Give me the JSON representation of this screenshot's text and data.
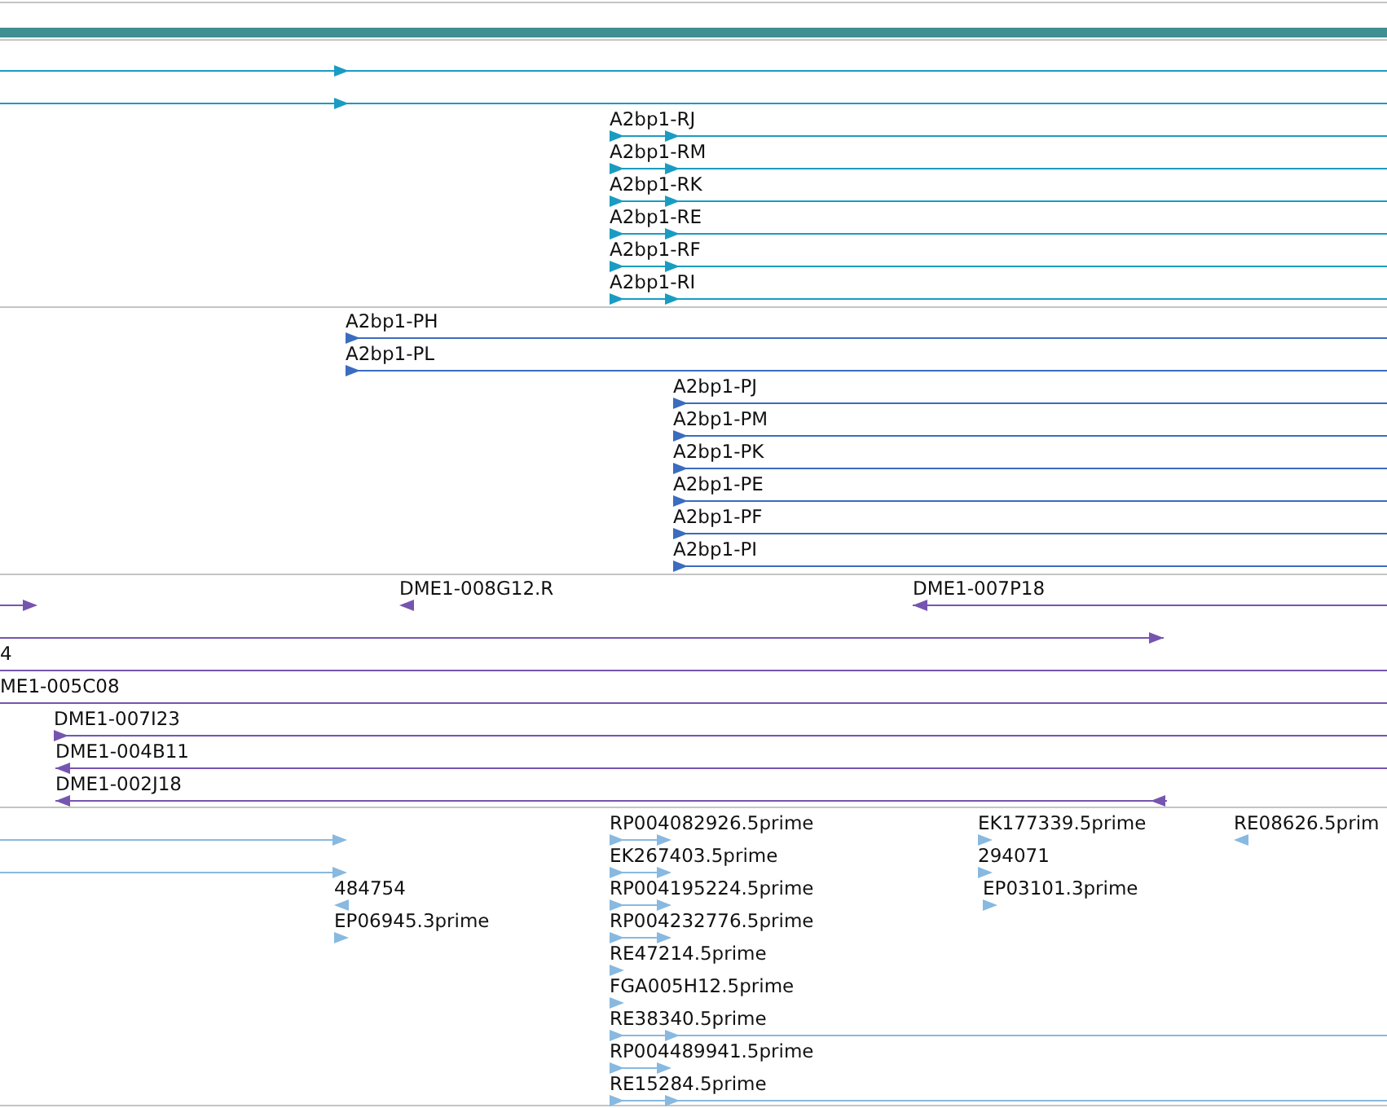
{
  "tracks": [
    {
      "kind": "bar",
      "color": "#3f8f92"
    },
    {
      "kind": "features",
      "color": "#1a9cc2",
      "features": [
        {
          "reverse": false
        },
        {
          "reverse": false
        },
        {
          "label": "A2bp1-RJ",
          "reverse": false
        },
        {
          "label": "A2bp1-RM",
          "reverse": false
        },
        {
          "label": "A2bp1-RK",
          "reverse": false
        },
        {
          "label": "A2bp1-RE",
          "reverse": false
        },
        {
          "label": "A2bp1-RF",
          "reverse": false
        },
        {
          "label": "A2bp1-RI",
          "reverse": false
        }
      ]
    },
    {
      "kind": "features",
      "color": "#3a6cc0",
      "features": [
        {
          "label": "A2bp1-PH",
          "reverse": false
        },
        {
          "label": "A2bp1-PL",
          "reverse": false
        },
        {
          "label": "A2bp1-PJ",
          "reverse": false
        },
        {
          "label": "A2bp1-PM",
          "reverse": false
        },
        {
          "label": "A2bp1-PK",
          "reverse": false
        },
        {
          "label": "A2bp1-PE",
          "reverse": false
        },
        {
          "label": "A2bp1-PF",
          "reverse": false
        },
        {
          "label": "A2bp1-PI",
          "reverse": false
        }
      ]
    },
    {
      "kind": "features",
      "color": "#7655b0",
      "features": [
        {
          "reverse": false
        },
        {
          "label": "DME1-008G12.R",
          "reverse": true
        },
        {
          "label": "DME1-007P18",
          "reverse": true
        },
        {
          "reverse": false
        },
        {
          "label": "4"
        },
        {
          "label": "ME1-005C08"
        },
        {
          "label": "DME1-007I23",
          "reverse": false
        },
        {
          "label": "DME1-004B11",
          "reverse": true
        },
        {
          "label": "DME1-002J18",
          "reverse": true
        }
      ]
    },
    {
      "kind": "features",
      "color": "#88b9e0",
      "features": [
        {
          "reverse": false
        },
        {
          "reverse": false
        },
        {
          "label": "484754",
          "reverse": true
        },
        {
          "label": "EP06945.3prime",
          "reverse": false
        },
        {
          "label": "RP004082926.5prime",
          "reverse": false
        },
        {
          "label": "EK267403.5prime",
          "reverse": false
        },
        {
          "label": "RP004195224.5prime",
          "reverse": false
        },
        {
          "label": "RP004232776.5prime",
          "reverse": false
        },
        {
          "label": "RE47214.5prime",
          "reverse": false
        },
        {
          "label": "FGA005H12.5prime",
          "reverse": false
        },
        {
          "label": "RE38340.5prime",
          "reverse": false
        },
        {
          "label": "RP004489941.5prime",
          "reverse": false
        },
        {
          "label": "RE15284.5prime",
          "reverse": false
        },
        {
          "label": "EK177339.5prime",
          "reverse": false
        },
        {
          "label": "294071",
          "reverse": false
        },
        {
          "label": "EP03101.3prime",
          "reverse": false
        },
        {
          "label": "RE08626.5prim",
          "reverse": true
        }
      ]
    }
  ]
}
